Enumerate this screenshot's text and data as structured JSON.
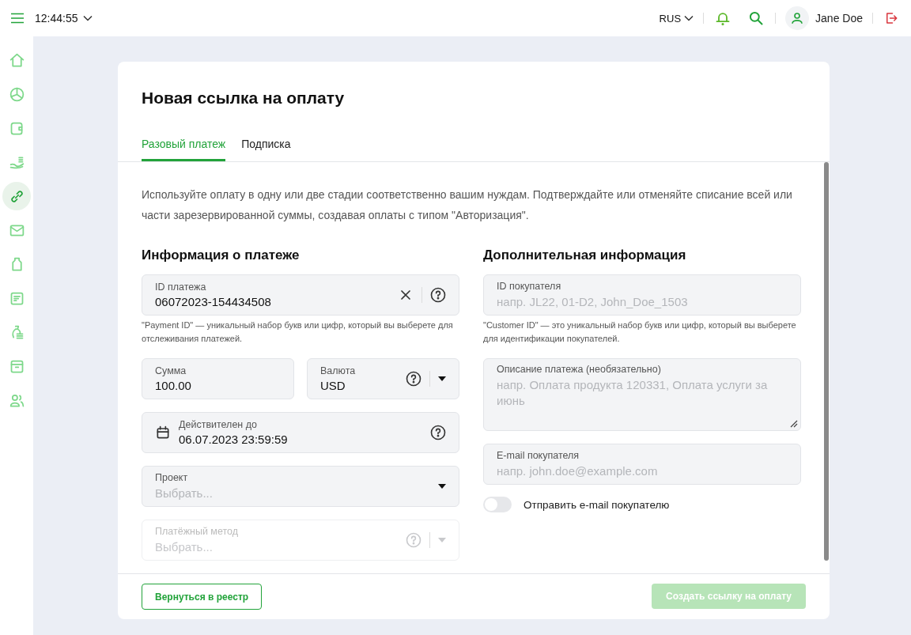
{
  "topbar": {
    "time": "12:44:55",
    "language": "RUS",
    "user": "Jane Doe"
  },
  "sidebar": {
    "items": [
      {
        "selected": false
      },
      {
        "selected": false
      },
      {
        "selected": false
      },
      {
        "selected": false
      },
      {
        "selected": true
      },
      {
        "selected": false
      },
      {
        "selected": false
      },
      {
        "selected": false
      },
      {
        "selected": false
      },
      {
        "selected": false
      },
      {
        "selected": false
      }
    ]
  },
  "page": {
    "title": "Новая ссылка на оплату",
    "tabs": [
      {
        "label": "Разовый платеж",
        "selected": true
      },
      {
        "label": "Подписка",
        "selected": false
      }
    ],
    "intro": "Используйте оплату в одну или две стадии соответственно вашим нуждам. Подтверждайте или отменяйте списание всей или части зарезервированной суммы, создавая оплаты с типом \"Авторизация\".",
    "left": {
      "heading": "Информация о платеже",
      "rows": [
        [
          {
            "kind": "text",
            "label": "ID платежа",
            "value": "06072023-154434508",
            "clearable": true,
            "help": true,
            "disabled": false,
            "hint": "\"Payment ID\" — уникальный набор букв или цифр, который вы выберете для отслеживания платежей."
          }
        ],
        [
          {
            "kind": "text",
            "label": "Сумма",
            "value": "100.00",
            "clearable": false,
            "help": false,
            "disabled": false
          },
          {
            "kind": "select",
            "label": "Валюта",
            "value": "USD",
            "clearable": false,
            "help": true,
            "disabled": false
          }
        ],
        [
          {
            "kind": "date",
            "label": "Действителен до",
            "value": "06.07.2023  23:59:59",
            "clearable": false,
            "help": true,
            "disabled": false
          }
        ],
        [
          {
            "kind": "select",
            "label": "Проект",
            "placeholder": "Выбрать...",
            "clearable": false,
            "help": false,
            "disabled": false
          }
        ],
        [
          {
            "kind": "select",
            "label": "Платёжный метод",
            "placeholder": "Выбрать...",
            "clearable": false,
            "help": true,
            "disabled": true
          }
        ]
      ]
    },
    "right": {
      "heading": "Дополнительная информация",
      "rows": [
        [
          {
            "kind": "text",
            "label": "ID покупателя",
            "placeholder": "напр. JL22, 01-D2, John_Doe_1503",
            "clearable": false,
            "help": false,
            "disabled": false,
            "hint": "\"Customer ID\" — это уникальный набор букв или цифр, который вы выберете для идентификации покупателей."
          }
        ],
        [
          {
            "kind": "textarea",
            "label": "Описание платежа (необязательно)",
            "placeholder": "напр. Оплата продукта 120331, Оплата услуги за июнь",
            "clearable": false,
            "help": false,
            "disabled": false
          }
        ],
        [
          {
            "kind": "text",
            "label": "E-mail покупателя",
            "placeholder": "напр. john.doe@example.com",
            "clearable": false,
            "help": false,
            "disabled": false
          }
        ]
      ]
    },
    "send_email": {
      "label": "Отправить e-mail покупателю",
      "on": false
    },
    "back_button": "Вернуться в реестр",
    "create_button": {
      "label": "Создать ссылку на оплату",
      "disabled": true
    }
  }
}
